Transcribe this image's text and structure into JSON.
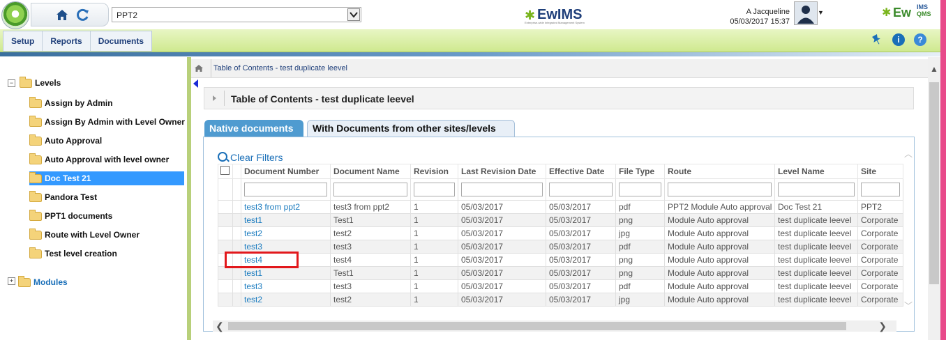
{
  "header": {
    "site_selected": "PPT2",
    "brand_center": "EwIMS",
    "brand_center_sub": "Enterprise-wide Integrated Management System",
    "brand_right_ew": "Ew",
    "brand_right_ims": "IMS",
    "brand_right_qms": "QMS",
    "user_name": "A Jacqueline",
    "date_time": "05/03/2017 15:37"
  },
  "menu": {
    "items": [
      "Setup",
      "Reports",
      "Documents"
    ]
  },
  "icons": {
    "home": "home-icon",
    "refresh": "refresh-icon",
    "pin": "pin-icon",
    "info": "info-icon",
    "help": "help-icon"
  },
  "colors": {
    "accent_blue": "#1f3f7a",
    "link_blue": "#1a7bbf",
    "menubar_green": "#cfe98f",
    "selected_row": "#3399ff",
    "highlight_red": "#e2181c",
    "tab_active": "#4f9bd0"
  },
  "tree": {
    "root": "Levels",
    "items": [
      "Assign by Admin",
      "Assign By Admin with Level Owner",
      "Auto Approval",
      "Auto Approval with level owner",
      "Doc Test 21",
      "Pandora Test",
      "PPT1 documents",
      "Route with Level Owner",
      "Test level creation"
    ],
    "selected": "Doc Test 21",
    "modules": "Modules"
  },
  "content": {
    "breadcrumb": "Table of Contents - test duplicate leevel",
    "panel_title": "Table of Contents - test duplicate leevel",
    "tabs": [
      "Native documents",
      "With Documents from other sites/levels"
    ],
    "clear_filters": "Clear Filters"
  },
  "grid": {
    "columns": [
      "Document Number",
      "Document Name",
      "Revision",
      "Last Revision Date",
      "Effective Date",
      "File Type",
      "Route",
      "Level Name",
      "Site"
    ],
    "rows": [
      [
        "test3 from ppt2",
        "test3 from ppt2",
        "1",
        "05/03/2017",
        "05/03/2017",
        "pdf",
        "PPT2 Module Auto approval",
        "Doc Test 21",
        "PPT2"
      ],
      [
        "test1",
        "Test1",
        "1",
        "05/03/2017",
        "05/03/2017",
        "png",
        "Module Auto approval",
        "test duplicate leevel",
        "Corporate"
      ],
      [
        "test2",
        "test2",
        "1",
        "05/03/2017",
        "05/03/2017",
        "jpg",
        "Module Auto approval",
        "test duplicate leevel",
        "Corporate"
      ],
      [
        "test3",
        "test3",
        "1",
        "05/03/2017",
        "05/03/2017",
        "pdf",
        "Module Auto approval",
        "test duplicate leevel",
        "Corporate"
      ],
      [
        "test4",
        "test4",
        "1",
        "05/03/2017",
        "05/03/2017",
        "png",
        "Module Auto approval",
        "test duplicate leevel",
        "Corporate"
      ],
      [
        "test1",
        "Test1",
        "1",
        "05/03/2017",
        "05/03/2017",
        "png",
        "Module Auto approval",
        "test duplicate leevel",
        "Corporate"
      ],
      [
        "test3",
        "test3",
        "1",
        "05/03/2017",
        "05/03/2017",
        "pdf",
        "Module Auto approval",
        "test duplicate leevel",
        "Corporate"
      ],
      [
        "test2",
        "test2",
        "1",
        "05/03/2017",
        "05/03/2017",
        "jpg",
        "Module Auto approval",
        "test duplicate leevel",
        "Corporate"
      ]
    ],
    "highlighted_row": "test4"
  }
}
